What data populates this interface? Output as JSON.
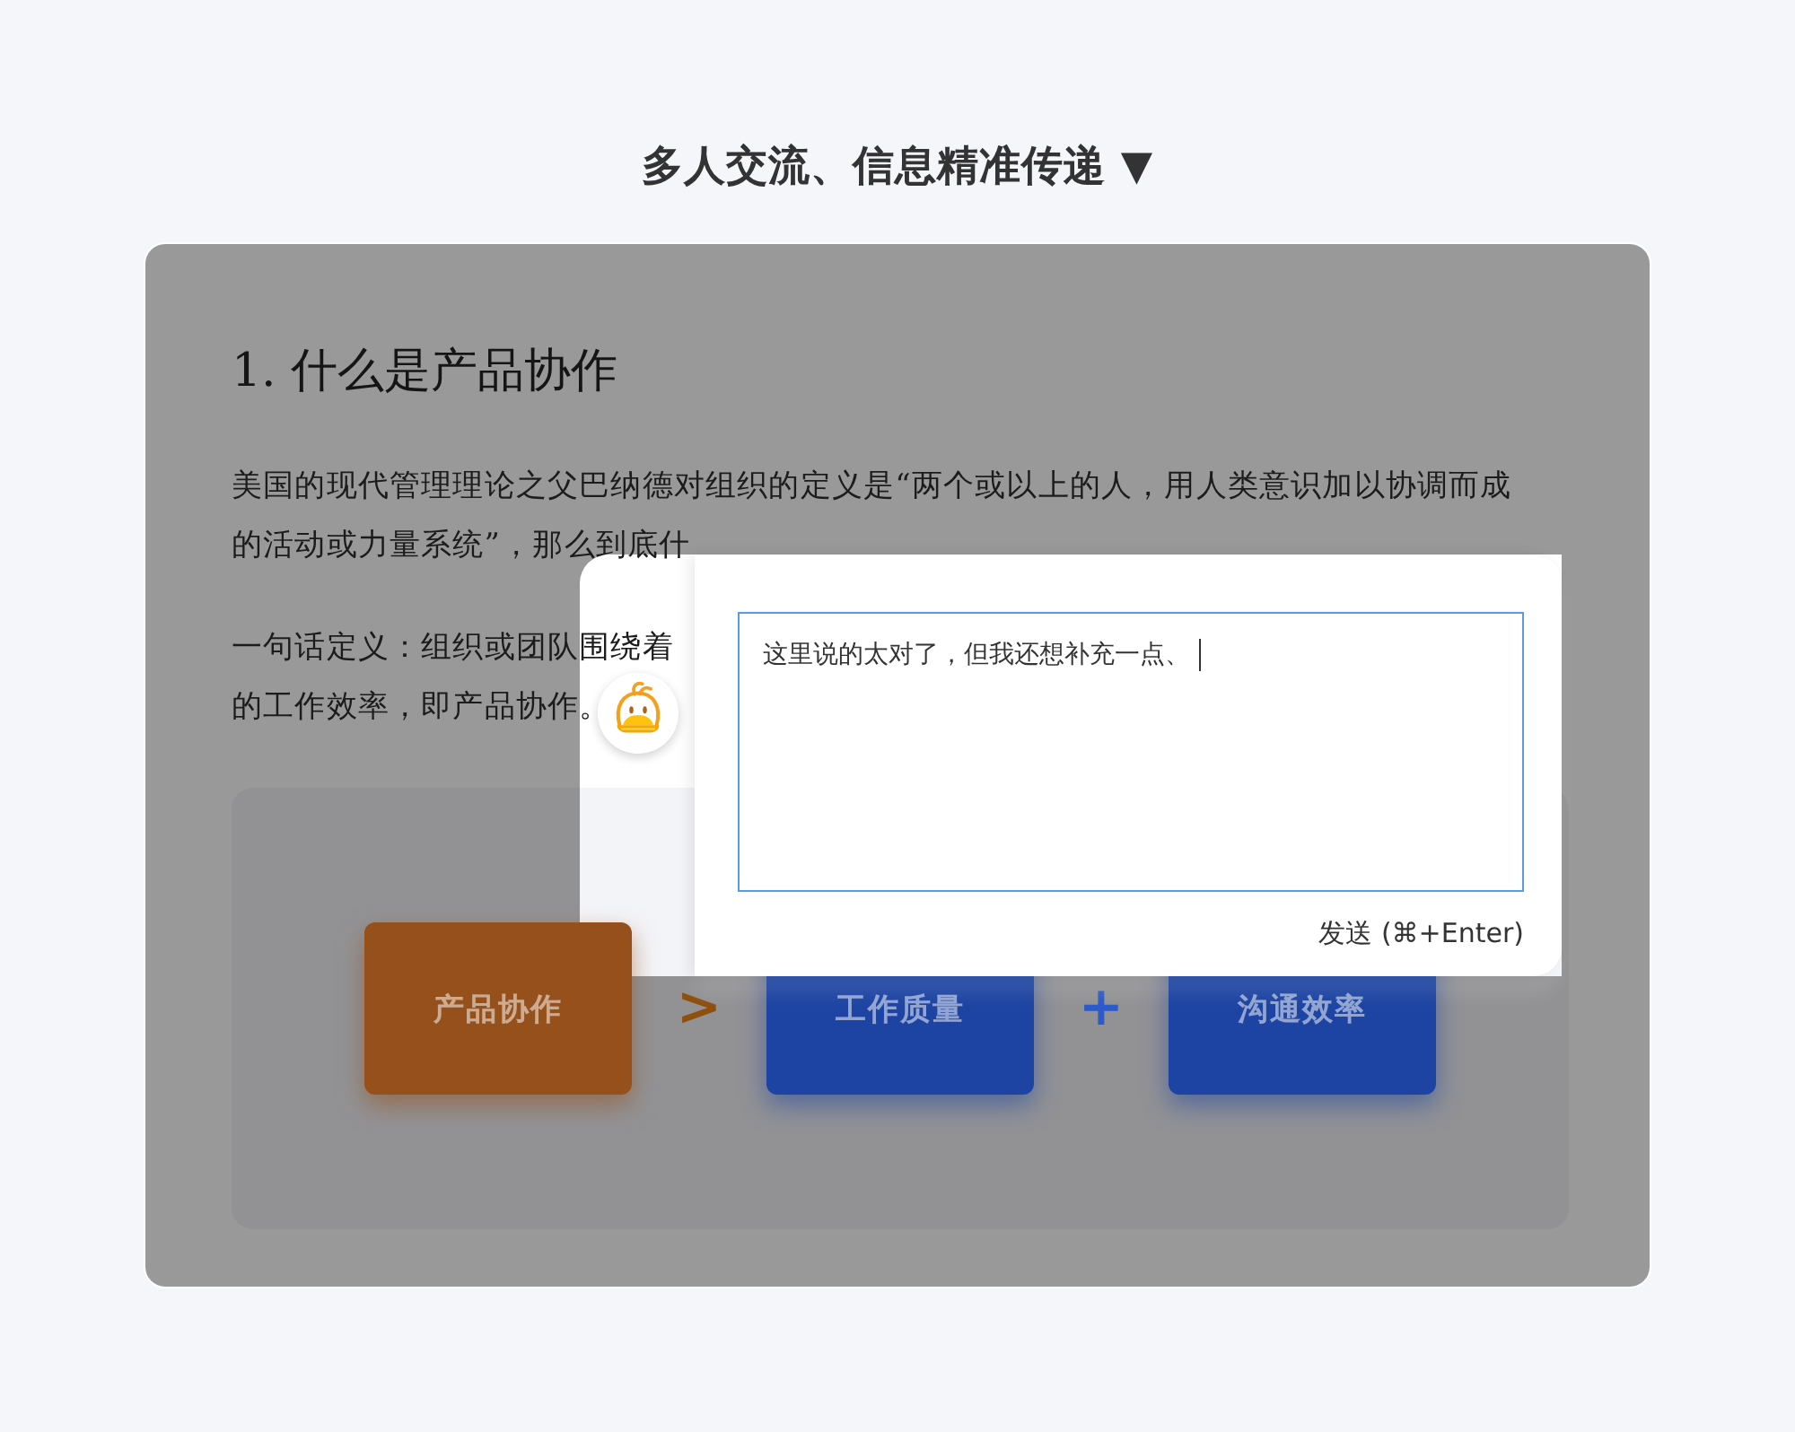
{
  "header": {
    "title": "多人交流、信息精准传递 ▼"
  },
  "document": {
    "heading": "1. 什么是产品协作",
    "paragraphs": [
      {
        "lines": [
          "美国的现代管理理论之父巴纳德对组织的定义是“两个或以上的人，用人类意识加以协调而成",
          "的活动或力量系统”，那么到底什"
        ]
      },
      {
        "lines": [
          "一句话定义：组织或团队围绕着",
          "的工作效率，即产品协作。"
        ]
      }
    ],
    "diagram": {
      "items": [
        {
          "kind": "box",
          "label": "产品协作",
          "color": "#95501b"
        },
        {
          "kind": "operator",
          "symbol": ">",
          "color": "#8f4f0e"
        },
        {
          "kind": "box",
          "label": "工作质量",
          "color": "#1d44a2"
        },
        {
          "kind": "operator",
          "symbol": "+",
          "color": "#2c5acb"
        },
        {
          "kind": "box",
          "label": "沟通效率",
          "color": "#1d44a2"
        }
      ]
    }
  },
  "comment_popup": {
    "input": {
      "value": "这里说的太对了，但我还想补充一点、",
      "focused": true
    },
    "send_button": "发送 (⌘+Enter)"
  }
}
